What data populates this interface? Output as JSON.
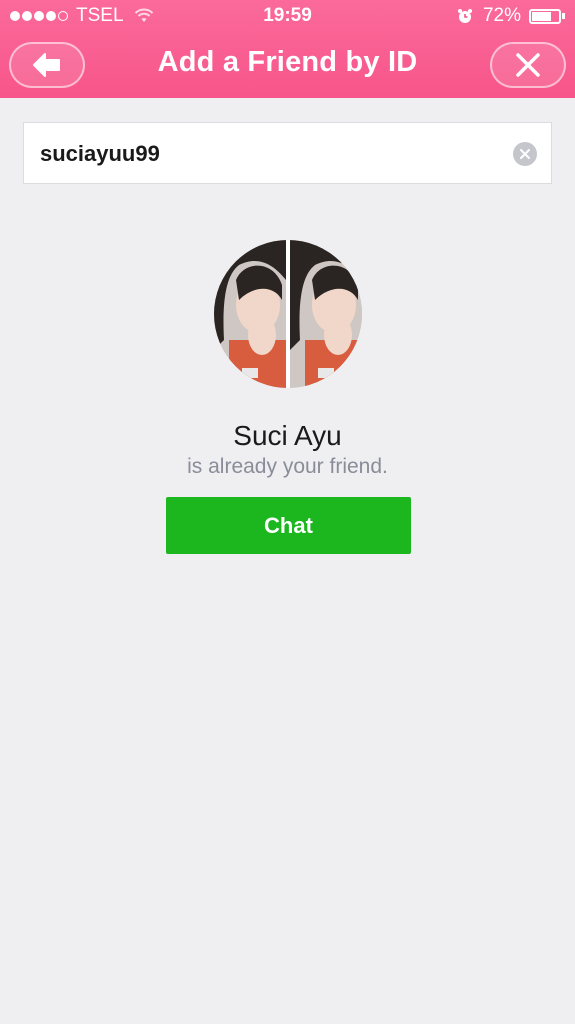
{
  "status_bar": {
    "carrier": "TSEL",
    "time": "19:59",
    "battery_percent": "72%",
    "battery_level": 0.72,
    "signal_bars": 4
  },
  "nav": {
    "title": "Add a Friend by ID",
    "back_icon": "back-arrow-icon",
    "close_icon": "close-icon"
  },
  "search": {
    "value": "suciayuu99",
    "clear_icon": "clear-icon"
  },
  "result": {
    "name": "Suci Ayu",
    "status": "is already your friend.",
    "chat_label": "Chat"
  },
  "colors": {
    "header": "#f7558a",
    "chat_button": "#1cb61e",
    "background": "#efeff2"
  }
}
